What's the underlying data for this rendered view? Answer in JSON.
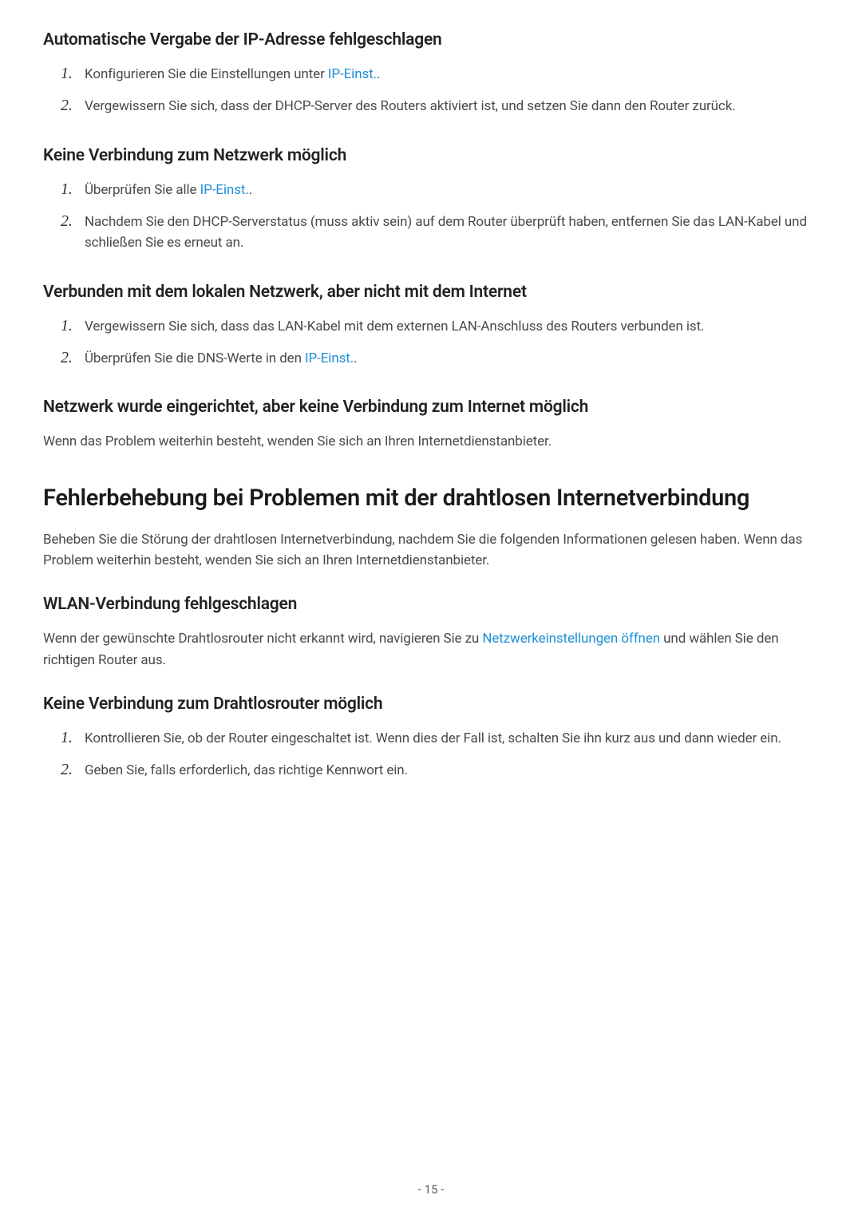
{
  "section1": {
    "heading": "Automatische Vergabe der IP-Adresse fehlgeschlagen",
    "items": [
      {
        "prefix": "Konfigurieren Sie die Einstellungen unter ",
        "link": "IP-Einst.",
        "suffix": "."
      },
      {
        "text": "Vergewissern Sie sich, dass der DHCP-Server des Routers aktiviert ist, und setzen Sie dann den Router zurück."
      }
    ]
  },
  "section2": {
    "heading": "Keine Verbindung zum Netzwerk möglich",
    "items": [
      {
        "prefix": "Überprüfen Sie alle ",
        "link": "IP-Einst.",
        "suffix": "."
      },
      {
        "text": "Nachdem Sie den DHCP-Serverstatus (muss aktiv sein) auf dem Router überprüft haben, entfernen Sie das LAN-Kabel und schließen Sie es erneut an."
      }
    ]
  },
  "section3": {
    "heading": "Verbunden mit dem lokalen Netzwerk, aber nicht mit dem Internet",
    "items": [
      {
        "text": "Vergewissern Sie sich, dass das LAN-Kabel mit dem externen LAN-Anschluss des Routers verbunden ist."
      },
      {
        "prefix": "Überprüfen Sie die DNS-Werte in den ",
        "link": "IP-Einst.",
        "suffix": "."
      }
    ]
  },
  "section4": {
    "heading": "Netzwerk wurde eingerichtet, aber keine Verbindung zum Internet möglich",
    "text": "Wenn das Problem weiterhin besteht, wenden Sie sich an Ihren Internetdienstanbieter."
  },
  "section5": {
    "heading": "Fehlerbehebung bei Problemen mit der drahtlosen Internetverbindung",
    "text": "Beheben Sie die Störung der drahtlosen Internetverbindung, nachdem Sie die folgenden Informationen gelesen haben. Wenn das Problem weiterhin besteht, wenden Sie sich an Ihren Internetdienstanbieter."
  },
  "section6": {
    "heading": "WLAN-Verbindung fehlgeschlagen",
    "prefix": "Wenn der gewünschte Drahtlosrouter nicht erkannt wird, navigieren Sie zu ",
    "link": "Netzwerkeinstellungen öffnen",
    "suffix": " und wählen Sie den richtigen Router aus."
  },
  "section7": {
    "heading": "Keine Verbindung zum Drahtlosrouter möglich",
    "items": [
      {
        "text": "Kontrollieren Sie, ob der Router eingeschaltet ist. Wenn dies der Fall ist, schalten Sie ihn kurz aus und dann wieder ein."
      },
      {
        "text": "Geben Sie, falls erforderlich, das richtige Kennwort ein."
      }
    ]
  },
  "pageNumber": "- 15 -"
}
